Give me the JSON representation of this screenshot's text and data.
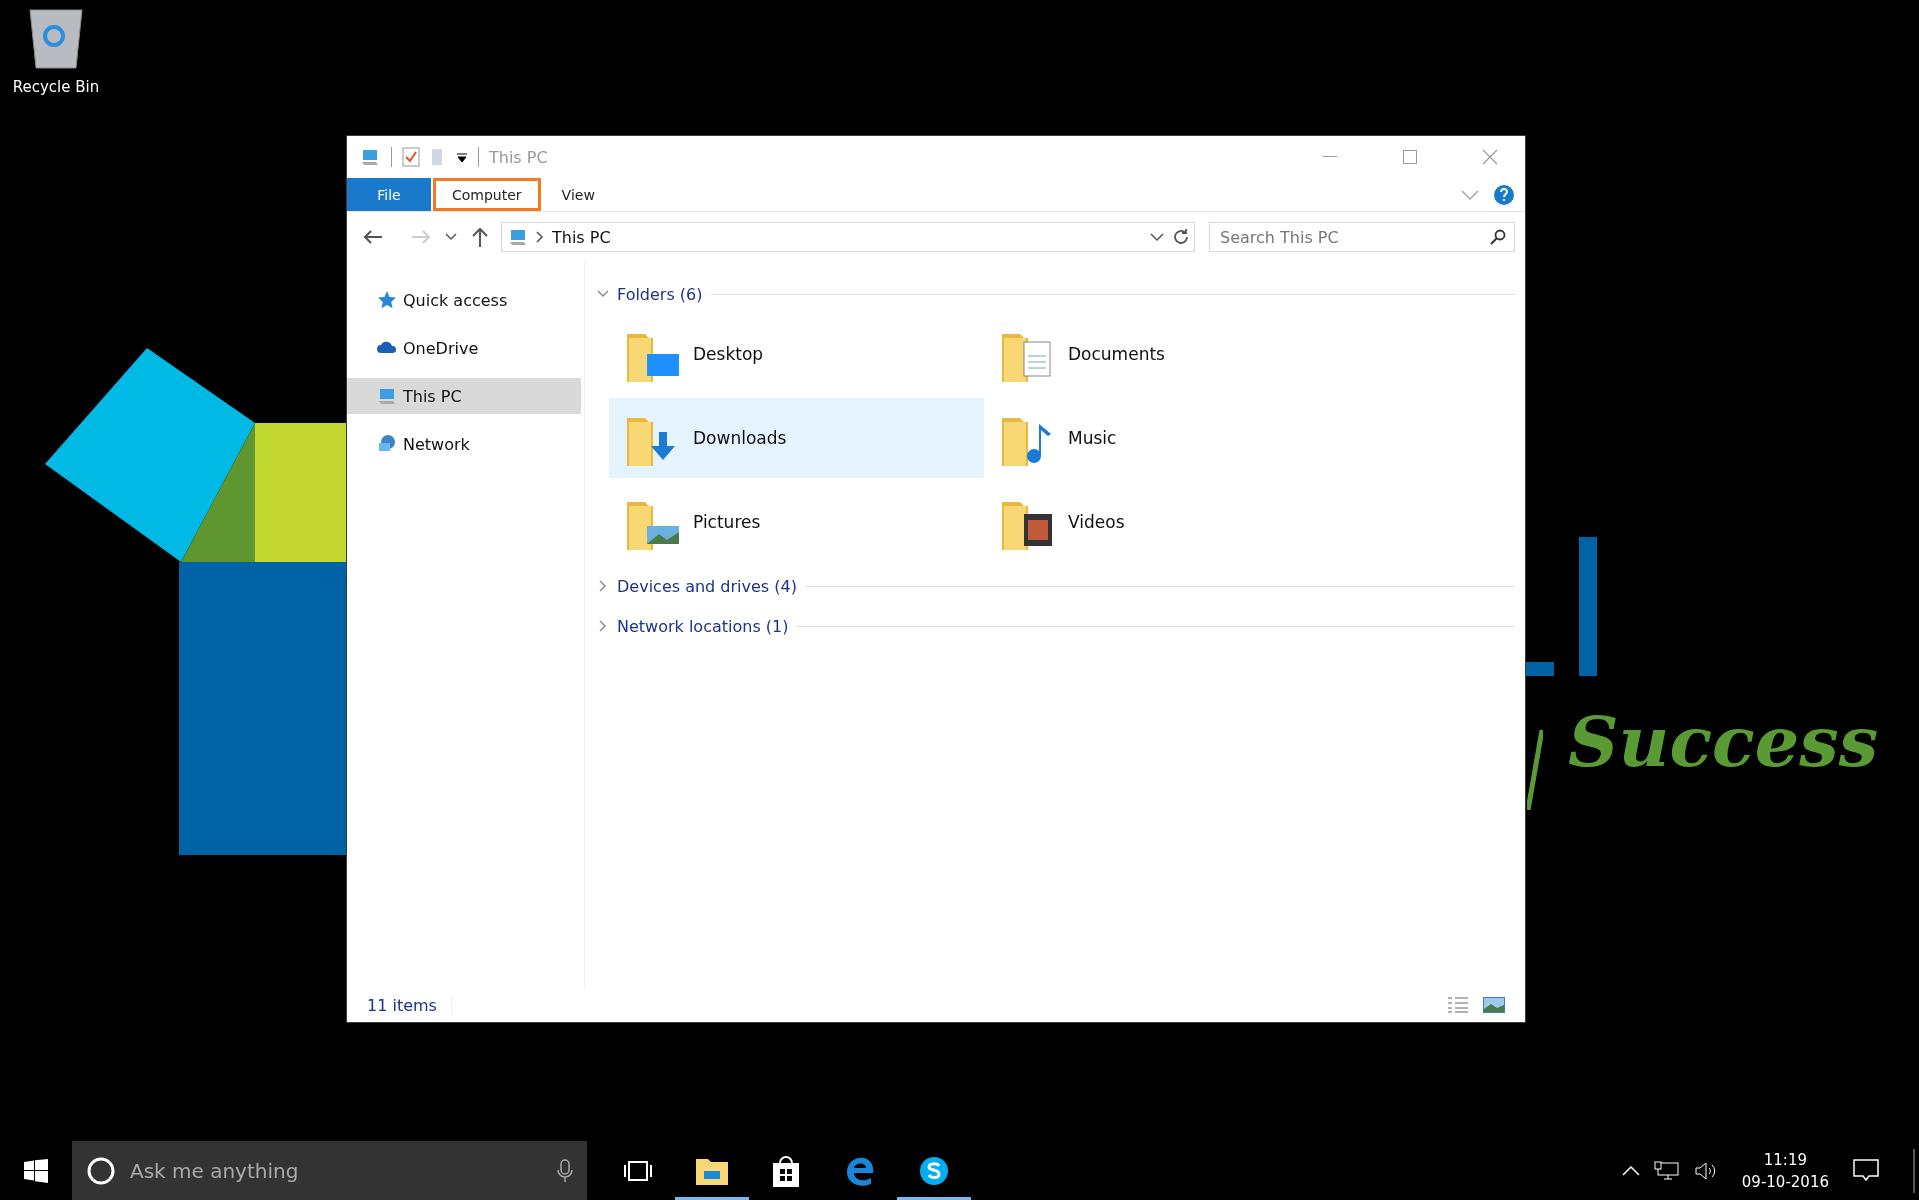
{
  "desktop_icons": [
    {
      "label": "Recycle Bin",
      "kind": "recycle-bin"
    }
  ],
  "wallpaper": {
    "tagline": "Success"
  },
  "window": {
    "title": "This PC",
    "ribbon_tabs": [
      {
        "label": "File",
        "kind": "file",
        "selected": false
      },
      {
        "label": "Computer",
        "kind": "tab",
        "selected": true
      },
      {
        "label": "View",
        "kind": "tab",
        "selected": false
      }
    ],
    "address": {
      "path": "This PC"
    },
    "search": {
      "placeholder": "Search This PC"
    },
    "nav": [
      {
        "label": "Quick access",
        "kind": "star",
        "selected": false
      },
      {
        "label": "OneDrive",
        "kind": "cloud",
        "selected": false
      },
      {
        "label": "This PC",
        "kind": "pc",
        "selected": true
      },
      {
        "label": "Network",
        "kind": "network",
        "selected": false
      }
    ],
    "groups": [
      {
        "title": "Folders (6)",
        "expanded": true,
        "items": [
          {
            "label": "Desktop",
            "kind": "desktop",
            "selected": false
          },
          {
            "label": "Documents",
            "kind": "documents",
            "selected": false
          },
          {
            "label": "Downloads",
            "kind": "downloads",
            "selected": true
          },
          {
            "label": "Music",
            "kind": "music",
            "selected": false
          },
          {
            "label": "Pictures",
            "kind": "pictures",
            "selected": false
          },
          {
            "label": "Videos",
            "kind": "videos",
            "selected": false
          }
        ]
      },
      {
        "title": "Devices and drives (4)",
        "expanded": false
      },
      {
        "title": "Network locations (1)",
        "expanded": false
      }
    ],
    "status_bar": {
      "count": "11 items"
    }
  },
  "taskbar": {
    "search_placeholder": "Ask me anything",
    "apps": [
      {
        "kind": "task-view",
        "running": false
      },
      {
        "kind": "explorer",
        "running": true
      },
      {
        "kind": "store",
        "running": false
      },
      {
        "kind": "edge",
        "running": false
      },
      {
        "kind": "skype",
        "running": true
      }
    ],
    "time": "11:19",
    "date": "09-10-2016"
  }
}
